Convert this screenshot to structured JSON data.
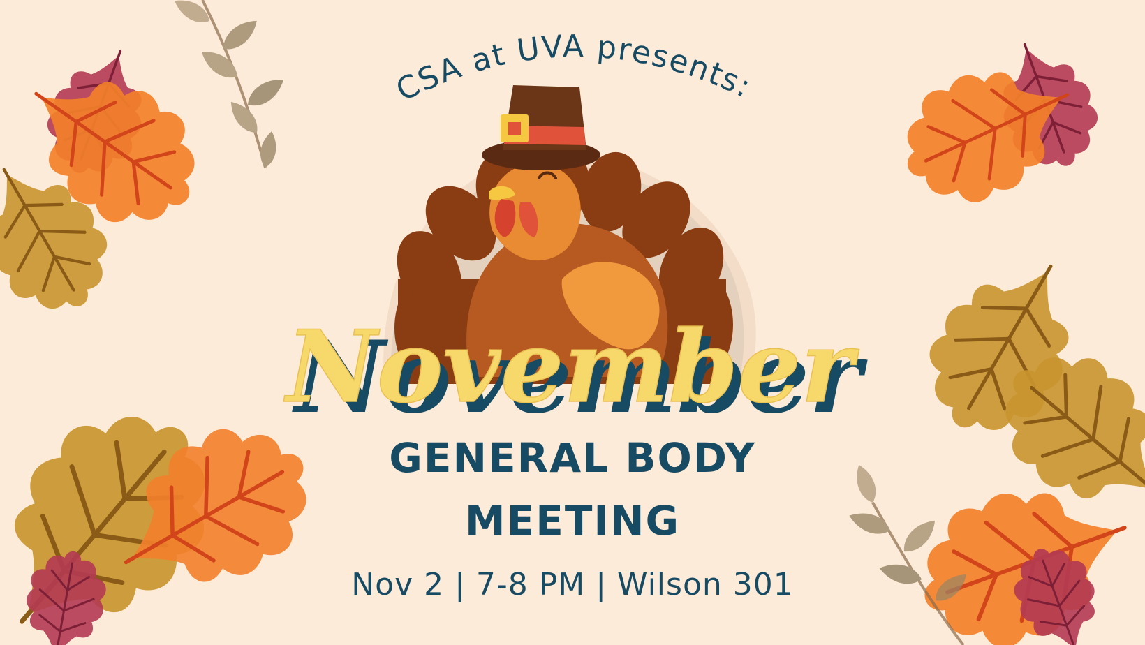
{
  "poster": {
    "presenter_line": "CSA at UVA presents:",
    "month_title": "November",
    "subtitle_line1": "GENERAL BODY",
    "subtitle_line2": "MEETING",
    "details": "Nov 2 | 7-8 PM | Wilson 301"
  },
  "colors": {
    "background": "#fdebd9",
    "navy": "#174a63",
    "yellow": "#f7d86a",
    "leaf_orange": "#f3802a",
    "leaf_gold": "#c9952f",
    "leaf_crimson": "#b23a52",
    "turkey_brown": "#7a3a12",
    "turkey_body": "#b65a22"
  },
  "icons": {
    "turkey": "turkey-pilgrim-hat-illustration",
    "leaves": "autumn-oak-leaf"
  }
}
